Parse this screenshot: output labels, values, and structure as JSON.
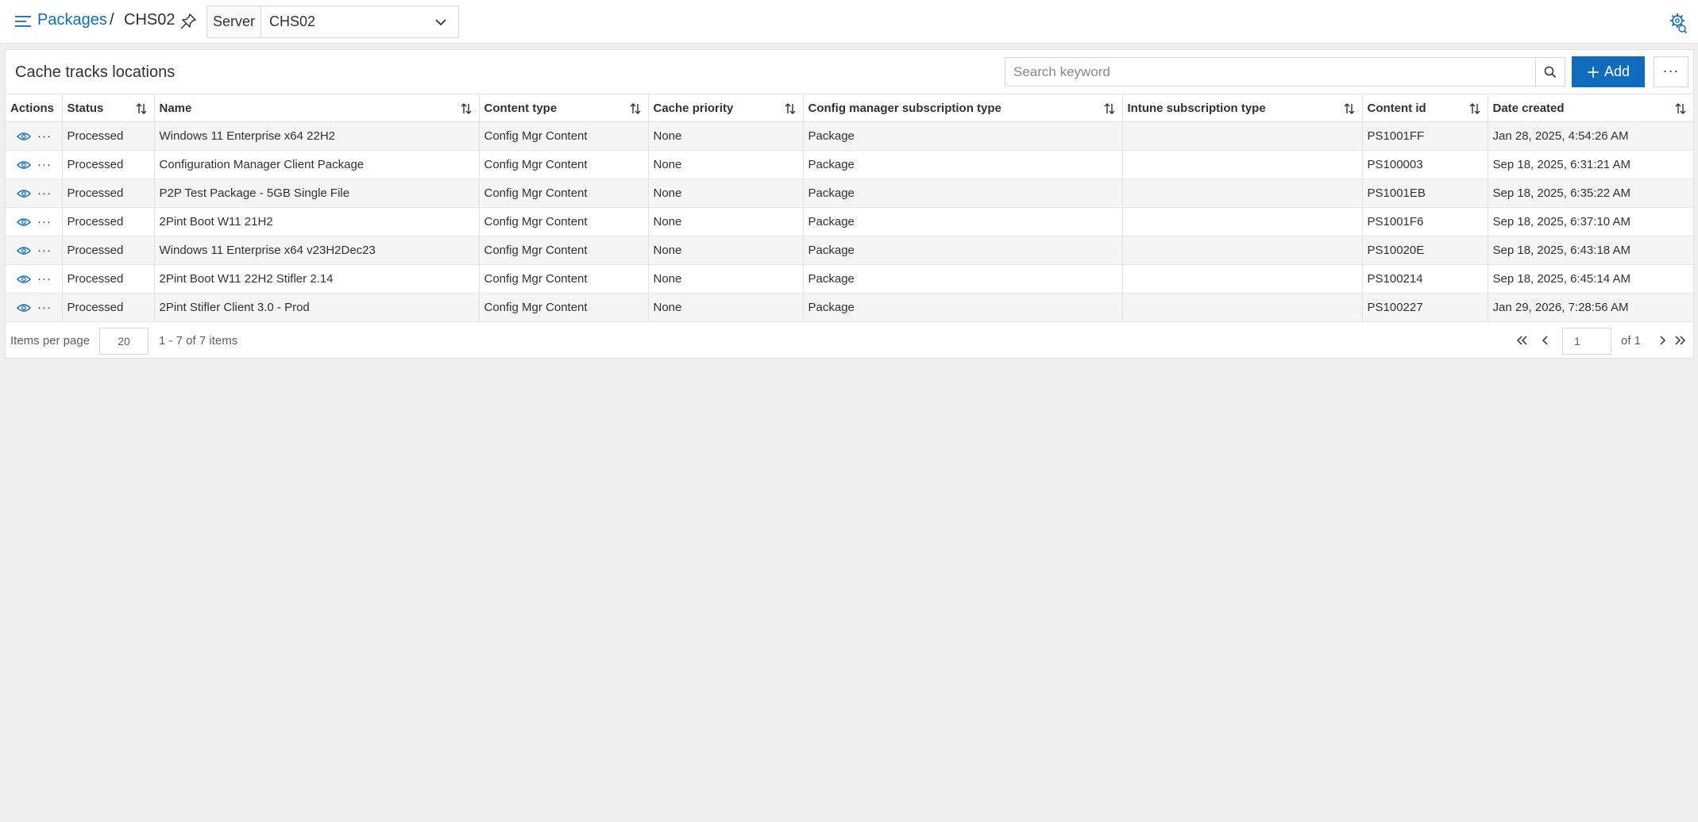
{
  "header": {
    "breadcrumb_root": "Packages",
    "breadcrumb_sep": "/",
    "breadcrumb_current": "CHS02",
    "server_label": "Server",
    "server_value": "CHS02"
  },
  "panel": {
    "title": "Cache tracks locations",
    "search_placeholder": "Search keyword",
    "add_label": "Add",
    "more_label": "···"
  },
  "columns": [
    "Actions",
    "Status",
    "Name",
    "Content type",
    "Cache priority",
    "Config manager subscription type",
    "Intune subscription type",
    "Content id",
    "Date created"
  ],
  "rows": [
    [
      "Processed",
      "Windows 11 Enterprise x64 22H2",
      "Config Mgr Content",
      "None",
      "Package",
      "",
      "PS1001FF",
      "Jan 28, 2025, 4:54:26 AM"
    ],
    [
      "Processed",
      "Configuration Manager Client Package",
      "Config Mgr Content",
      "None",
      "Package",
      "",
      "PS100003",
      "Sep 18, 2025, 6:31:21 AM"
    ],
    [
      "Processed",
      "P2P Test Package - 5GB Single File",
      "Config Mgr Content",
      "None",
      "Package",
      "",
      "PS1001EB",
      "Sep 18, 2025, 6:35:22 AM"
    ],
    [
      "Processed",
      "2Pint Boot W11 21H2",
      "Config Mgr Content",
      "None",
      "Package",
      "",
      "PS1001F6",
      "Sep 18, 2025, 6:37:10 AM"
    ],
    [
      "Processed",
      "Windows 11 Enterprise x64 v23H2Dec23",
      "Config Mgr Content",
      "None",
      "Package",
      "",
      "PS10020E",
      "Sep 18, 2025, 6:43:18 AM"
    ],
    [
      "Processed",
      "2Pint Boot W11 22H2 Stifler 2.14",
      "Config Mgr Content",
      "None",
      "Package",
      "",
      "PS100214",
      "Sep 18, 2025, 6:45:14 AM"
    ],
    [
      "Processed",
      "2Pint Stifler Client 3.0 - Prod",
      "Config Mgr Content",
      "None",
      "Package",
      "",
      "PS100227",
      "Jan 29, 2026, 7:28:56 AM"
    ]
  ],
  "pager": {
    "items_per_page_label": "Items per page",
    "items_per_page": "20",
    "range_text": "1 - 7 of 7 items",
    "current_page": "1",
    "of_text": "of 1"
  },
  "colors": {
    "accent": "#0f6cbd",
    "background": "#efefef",
    "row_alt": "#f5f5f5"
  }
}
